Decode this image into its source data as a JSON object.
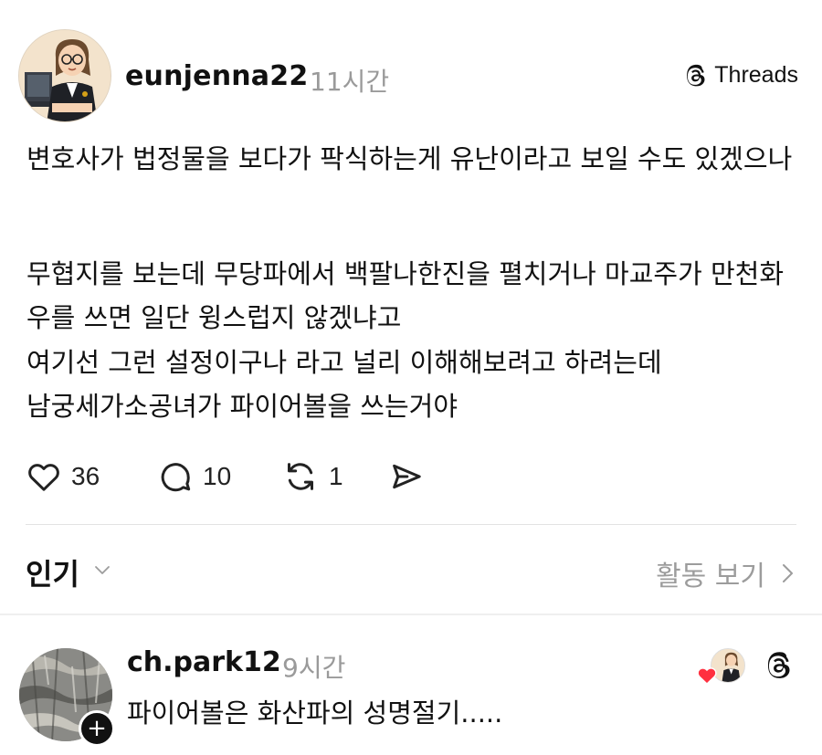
{
  "post": {
    "author": "eunjenna22",
    "time": "11시간",
    "brand": "Threads",
    "paragraphs": [
      "변호사가 법정물을 보다가 팍식하는게 유난이라고 보일 수도 있겠으나",
      "무협지를 보는데 무당파에서 백팔나한진을 펼치거나 마교주가 만천화우를 쓰면 일단 윙스럽지 않겠냐고",
      "여기선 그런 설정이구나 라고 널리 이해해보려고 하려는데\n남궁세가소공녀가 파이어볼을 쓰는거야"
    ],
    "actions": {
      "likes": "36",
      "replies": "10",
      "reposts": "1"
    },
    "icons": [
      "heart-icon",
      "comment-icon",
      "repost-icon",
      "share-icon",
      "threads-logo-icon",
      "chevron-down-icon",
      "chevron-right-icon",
      "plus-icon"
    ]
  },
  "sort": {
    "label": "인기",
    "activity_label": "활동 보기"
  },
  "reply": {
    "author": "ch.park12",
    "time": "9시간",
    "text": "파이어볼은 화산파의 성명절기.....",
    "follow_symbol": "+",
    "accent_heart_color": "#ff3040"
  }
}
